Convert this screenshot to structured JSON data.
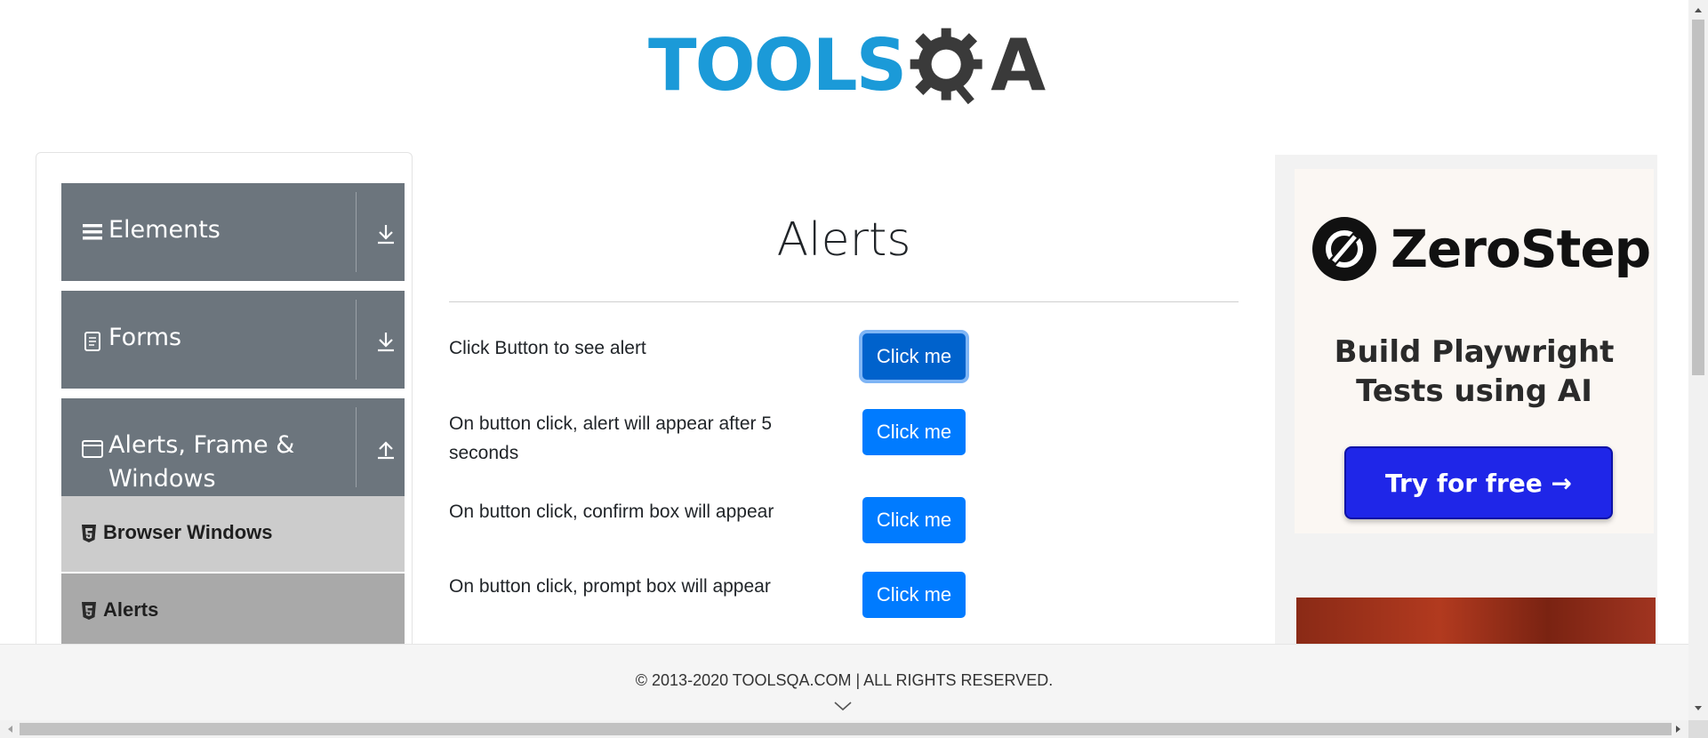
{
  "logo": {
    "part1": "TOOLS",
    "part2": "QA"
  },
  "sidebar": {
    "groups": [
      {
        "label": "Elements",
        "icon": "hamburger-icon",
        "toggle": "download-arrow-icon"
      },
      {
        "label": "Forms",
        "icon": "document-icon",
        "toggle": "download-arrow-icon"
      },
      {
        "label_line1": "Alerts, Frame &",
        "label_line2": "Windows",
        "icon": "window-icon",
        "toggle": "upload-arrow-icon"
      }
    ],
    "items": [
      {
        "label": "Browser Windows",
        "icon": "html5-icon"
      },
      {
        "label": "Alerts",
        "icon": "html5-icon"
      }
    ]
  },
  "main": {
    "title": "Alerts",
    "rows": [
      {
        "text": "Click Button to see alert",
        "button": "Click me"
      },
      {
        "text": "On button click, alert will appear after 5 seconds",
        "button": "Click me"
      },
      {
        "text": "On button click, confirm box will appear",
        "button": "Click me"
      },
      {
        "text": "On button click, prompt box will appear",
        "button": "Click me"
      }
    ]
  },
  "ad": {
    "brand": "ZeroStep",
    "headline_line1": "Build Playwright",
    "headline_line2": "Tests using AI",
    "cta": "Try for free →"
  },
  "footer": {
    "text": "© 2013-2020 TOOLSQA.COM | ALL RIGHTS RESERVED."
  },
  "colors": {
    "primary": "#007bff",
    "sidebar_group": "#6c757d",
    "sidebar_item_light": "#cccccc",
    "sidebar_item_active": "#a9a9a9",
    "logo_blue": "#1b9ad8",
    "logo_dark": "#3a3a3a",
    "ad_cta": "#1f26e8"
  }
}
